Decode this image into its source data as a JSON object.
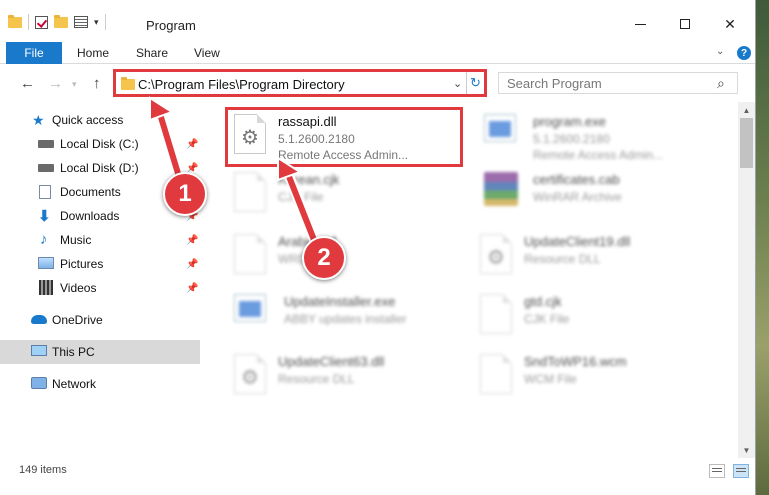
{
  "window": {
    "title": "Program",
    "controls": {
      "minimize": "minimize",
      "maximize": "maximize",
      "close": "✕"
    }
  },
  "ribbon": {
    "tabs": [
      {
        "label": "File",
        "active": true
      },
      {
        "label": "Home"
      },
      {
        "label": "Share"
      },
      {
        "label": "View"
      }
    ]
  },
  "navigation": {
    "back": "←",
    "forward": "→",
    "up": "↑",
    "address": "C:\\Program Files\\Program Directory",
    "search_placeholder": "Search Program"
  },
  "sidebar": {
    "items": [
      {
        "label": "Quick access",
        "icon": "star-icon",
        "pinned": false
      },
      {
        "label": "Local Disk (C:)",
        "icon": "drive-icon",
        "pinned": true
      },
      {
        "label": "Local Disk (D:)",
        "icon": "drive-icon",
        "pinned": true
      },
      {
        "label": "Documents",
        "icon": "documents-icon",
        "pinned": true
      },
      {
        "label": "Downloads",
        "icon": "downloads-icon",
        "pinned": true
      },
      {
        "label": "Music",
        "icon": "music-icon",
        "pinned": true
      },
      {
        "label": "Pictures",
        "icon": "pictures-icon",
        "pinned": true
      },
      {
        "label": "Videos",
        "icon": "videos-icon",
        "pinned": true
      },
      {
        "label": "OneDrive",
        "icon": "onedrive-icon",
        "pinned": false
      },
      {
        "label": "This PC",
        "icon": "computer-icon",
        "pinned": false,
        "selected": true
      },
      {
        "label": "Network",
        "icon": "network-icon",
        "pinned": false
      }
    ]
  },
  "files": [
    {
      "name": "rassapi.dll",
      "line2": "5.1.2600.2180",
      "line3": "Remote Access Admin...",
      "icon": "dll-gear-icon",
      "highlighted": true
    },
    {
      "name": "program.exe",
      "line2": "5.1.2600.2180",
      "line3": "Remote Access Admin...",
      "icon": "exe-icon"
    },
    {
      "name": "Korean.cjk",
      "line2": "CJK File",
      "icon": "blank-file-icon"
    },
    {
      "name": "certificates.cab",
      "line2": "WinRAR Archive",
      "icon": "cab-archive-icon"
    },
    {
      "name": "Arabic.cnf",
      "line2": "WRD File",
      "icon": "blank-file-icon"
    },
    {
      "name": "UpdateClient19.dll",
      "line2": "Resource DLL",
      "icon": "dll-gear-icon"
    },
    {
      "name": "UpdateInstaller.exe",
      "line2": "ABBY updates installer",
      "icon": "exe-icon"
    },
    {
      "name": "gtd.cjk",
      "line2": "CJK File",
      "icon": "blank-file-icon"
    },
    {
      "name": "UpdateClient63.dll",
      "line2": "Resource DLL",
      "icon": "dll-gear-icon"
    },
    {
      "name": "SndToWP16.wcm",
      "line2": "WCM File",
      "icon": "blank-file-icon"
    }
  ],
  "status": {
    "count": "149 items"
  },
  "annotations": {
    "step1": "1",
    "step2": "2",
    "color": "#e0393e"
  },
  "colors": {
    "accent": "#1979ca",
    "highlight": "#e0393e"
  }
}
